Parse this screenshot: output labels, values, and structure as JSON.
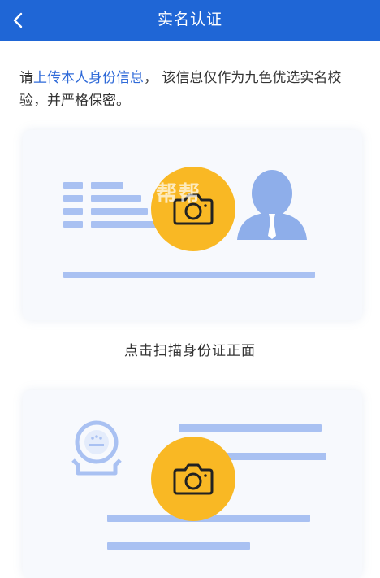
{
  "header": {
    "title": "实名认证",
    "back_icon": "chevron-left-icon",
    "color": "#1f66d6"
  },
  "intro": {
    "prefix": "请",
    "highlight": "上传本人身份信息",
    "suffix": "， 该信息仅作为九色优选实名校验，并严格保密。"
  },
  "front_card": {
    "caption": "点击扫描身份证正面",
    "camera_icon": "camera-icon",
    "person_icon": "person-silhouette-icon"
  },
  "back_card": {
    "camera_icon": "camera-icon",
    "emblem_icon": "national-emblem-icon"
  },
  "watermark": "帮帮",
  "colors": {
    "accent": "#1f66d6",
    "camera_button": "#f9b824",
    "card_lines": "#a9c1f2"
  }
}
